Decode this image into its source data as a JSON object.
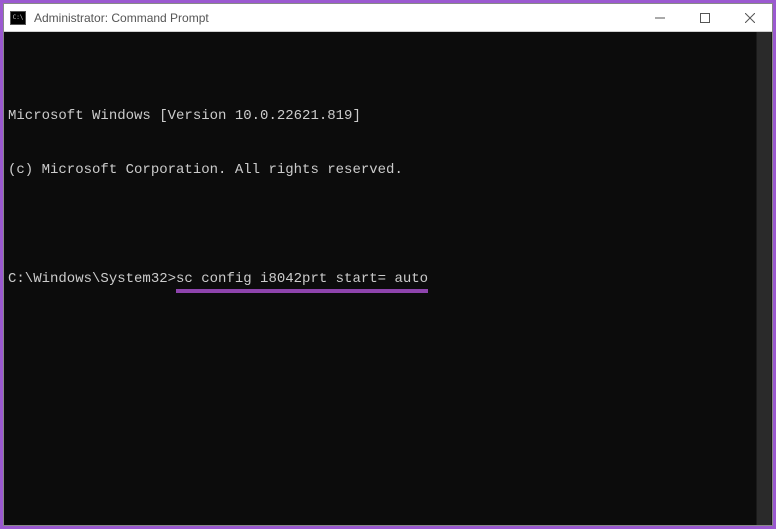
{
  "window": {
    "title": "Administrator: Command Prompt"
  },
  "terminal": {
    "header_line1": "Microsoft Windows [Version 10.0.22621.819]",
    "header_line2": "(c) Microsoft Corporation. All rights reserved.",
    "prompt": "C:\\Windows\\System32>",
    "command": "sc config i8042prt start= auto"
  },
  "colors": {
    "accent_border": "#9b59d0",
    "underline": "#8e44ad",
    "terminal_bg": "#0c0c0c",
    "terminal_fg": "#cccccc"
  }
}
